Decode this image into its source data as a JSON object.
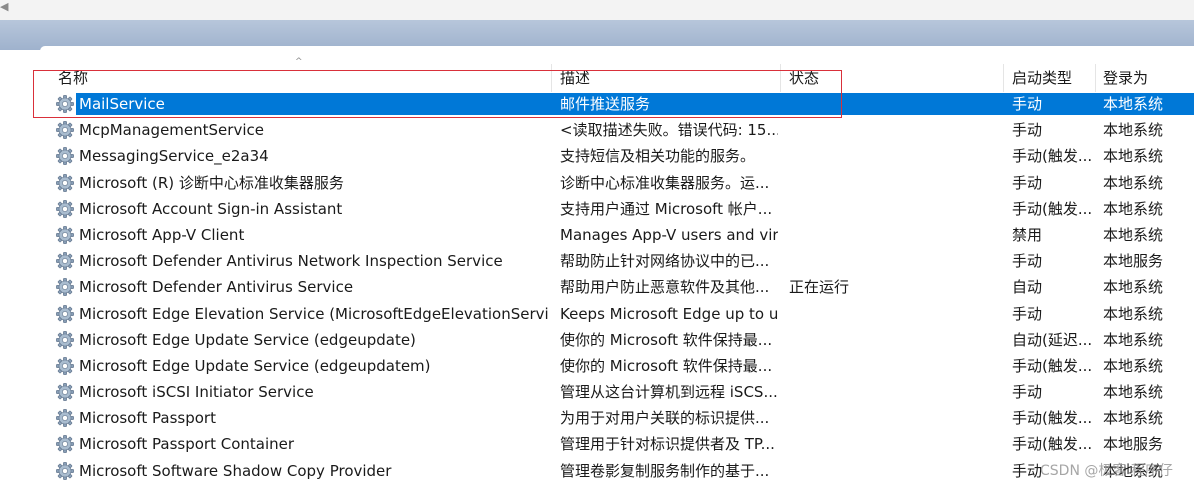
{
  "columns": {
    "name": "名称",
    "description": "描述",
    "status": "状态",
    "startup_type": "启动类型",
    "logon_as": "登录为"
  },
  "icons": {
    "service": "gear-icon",
    "sort": "sort-ascending-icon",
    "back": "left-arrow-icon"
  },
  "colors": {
    "selection": "#0078d7",
    "highlight_box": "#d9303a",
    "title_band": "#a8b9d2"
  },
  "rows": [
    {
      "name": "MailService",
      "description": "邮件推送服务",
      "status": "",
      "startup": "手动",
      "logon": "本地系统",
      "selected": true
    },
    {
      "name": "McpManagementService",
      "description": "<读取描述失败。错误代码: 15...",
      "status": "",
      "startup": "手动",
      "logon": "本地系统"
    },
    {
      "name": "MessagingService_e2a34",
      "description": "支持短信及相关功能的服务。",
      "status": "",
      "startup": "手动(触发...",
      "logon": "本地系统"
    },
    {
      "name": "Microsoft (R) 诊断中心标准收集器服务",
      "description": "诊断中心标准收集器服务。运...",
      "status": "",
      "startup": "手动",
      "logon": "本地系统"
    },
    {
      "name": "Microsoft Account Sign-in Assistant",
      "description": "支持用户通过 Microsoft 帐户...",
      "status": "",
      "startup": "手动(触发...",
      "logon": "本地系统"
    },
    {
      "name": "Microsoft App-V Client",
      "description": "Manages App-V users and virt...",
      "status": "",
      "startup": "禁用",
      "logon": "本地系统"
    },
    {
      "name": "Microsoft Defender Antivirus Network Inspection Service",
      "description": "帮助防止针对网络协议中的已...",
      "status": "",
      "startup": "手动",
      "logon": "本地服务"
    },
    {
      "name": "Microsoft Defender Antivirus Service",
      "description": "帮助用户防止恶意软件及其他...",
      "status": "正在运行",
      "startup": "自动",
      "logon": "本地系统"
    },
    {
      "name": "Microsoft Edge Elevation Service (MicrosoftEdgeElevationService)",
      "description": "Keeps Microsoft Edge up to u...",
      "status": "",
      "startup": "手动",
      "logon": "本地系统"
    },
    {
      "name": "Microsoft Edge Update Service (edgeupdate)",
      "description": "使你的 Microsoft 软件保持最...",
      "status": "",
      "startup": "自动(延迟...",
      "logon": "本地系统"
    },
    {
      "name": "Microsoft Edge Update Service (edgeupdatem)",
      "description": "使你的 Microsoft 软件保持最...",
      "status": "",
      "startup": "手动(触发...",
      "logon": "本地系统"
    },
    {
      "name": "Microsoft iSCSI Initiator Service",
      "description": "管理从这台计算机到远程 iSCS...",
      "status": "",
      "startup": "手动",
      "logon": "本地系统"
    },
    {
      "name": "Microsoft Passport",
      "description": "为用于对用户关联的标识提供...",
      "status": "",
      "startup": "手动(触发...",
      "logon": "本地系统"
    },
    {
      "name": "Microsoft Passport Container",
      "description": "管理用于针对标识提供者及 TP...",
      "status": "",
      "startup": "手动(触发...",
      "logon": "本地服务"
    },
    {
      "name": "Microsoft Software Shadow Copy Provider",
      "description": "管理卷影复制服务制作的基于...",
      "status": "",
      "startup": "手动",
      "logon": "本地系统"
    }
  ],
  "watermark": "CSDN @极客 程序仔"
}
